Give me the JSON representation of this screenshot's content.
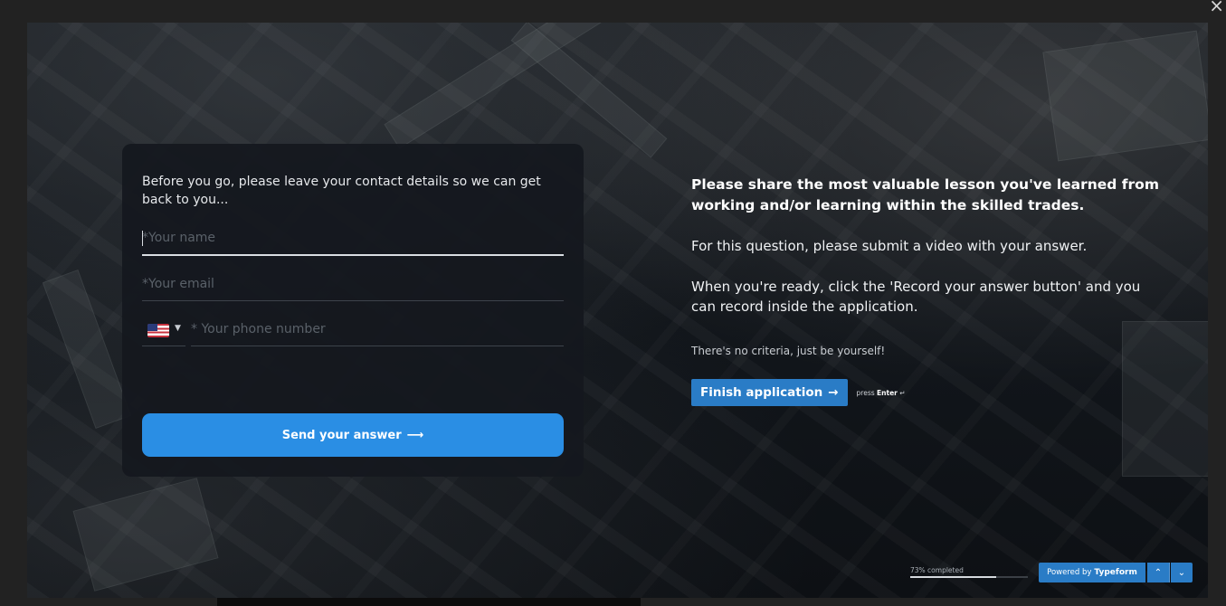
{
  "window": {
    "close_glyph": "×"
  },
  "contact_form": {
    "intro": "Before you go, please leave your contact details so we can get back to you...",
    "name_placeholder": "*Your name",
    "name_value": "",
    "email_placeholder": "*Your email",
    "email_value": "",
    "phone_country": "US",
    "phone_placeholder": "* Your phone number",
    "phone_value": "",
    "send_label": "Send your answer",
    "send_arrow": "⟶"
  },
  "question": {
    "title": "Please share the most valuable lesson you've learned from working and/or learning within the skilled trades.",
    "paragraph_1": "For this question, please submit a video with your answer.",
    "paragraph_2": "When you're ready, click the 'Record your answer button' and you can record inside the application.",
    "note": "There's no criteria, just be yourself!",
    "finish_label": "Finish application",
    "finish_arrow": "→",
    "press_text": "press",
    "press_key": "Enter",
    "press_glyph": "↵"
  },
  "footer": {
    "progress_label": "73% completed",
    "progress_percent": 73,
    "powered_prefix": "Powered by",
    "powered_brand": "Typeform",
    "up_glyph": "⌃",
    "down_glyph": "⌄"
  },
  "colors": {
    "accent": "#2a8ee4",
    "button_blue": "#2a7cc6",
    "card_bg": "#14181e"
  },
  "icons": {
    "close": "close-icon",
    "flag": "us-flag-icon",
    "chevron": "chevron-down-icon",
    "arrow": "arrow-right-icon",
    "enter": "enter-key-icon",
    "up": "chevron-up-icon",
    "down": "chevron-down-icon"
  }
}
